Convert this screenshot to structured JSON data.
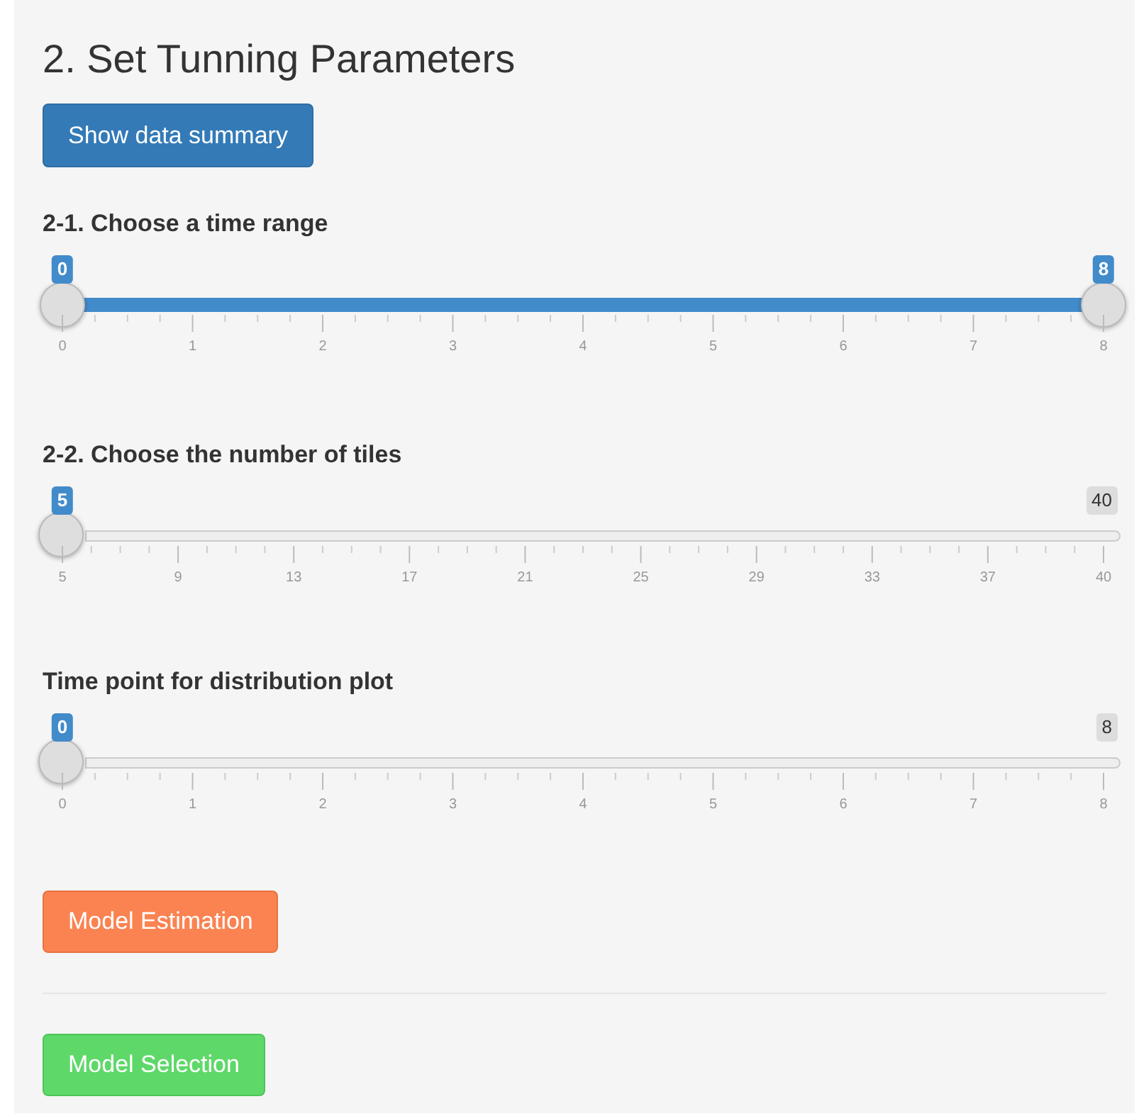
{
  "title": "2. Set Tunning Parameters",
  "summary_button": "Show data summary",
  "sliders": [
    {
      "label": "2-1. Choose a time range",
      "kind": "range",
      "handles": [
        {
          "value": "0",
          "level": 0
        },
        {
          "value": "8",
          "level": 1
        }
      ],
      "ticks": [
        "0",
        "1",
        "2",
        "3",
        "4",
        "5",
        "6",
        "7",
        "8"
      ]
    },
    {
      "label": "2-2. Choose the number of tiles",
      "kind": "single",
      "handles": [
        {
          "value": "5",
          "level": 0
        }
      ],
      "max_label": "40",
      "ticks": [
        "5",
        "9",
        "13",
        "17",
        "21",
        "25",
        "29",
        "33",
        "37",
        "40"
      ]
    },
    {
      "label": "Time point for distribution plot",
      "kind": "single",
      "handles": [
        {
          "value": "0",
          "level": 0
        }
      ],
      "max_label": "8",
      "ticks": [
        "0",
        "1",
        "2",
        "3",
        "4",
        "5",
        "6",
        "7",
        "8"
      ]
    }
  ],
  "actions": [
    {
      "label": "Model Estimation",
      "kind": "warning"
    },
    {
      "label": "Model Selection",
      "kind": "success"
    }
  ]
}
